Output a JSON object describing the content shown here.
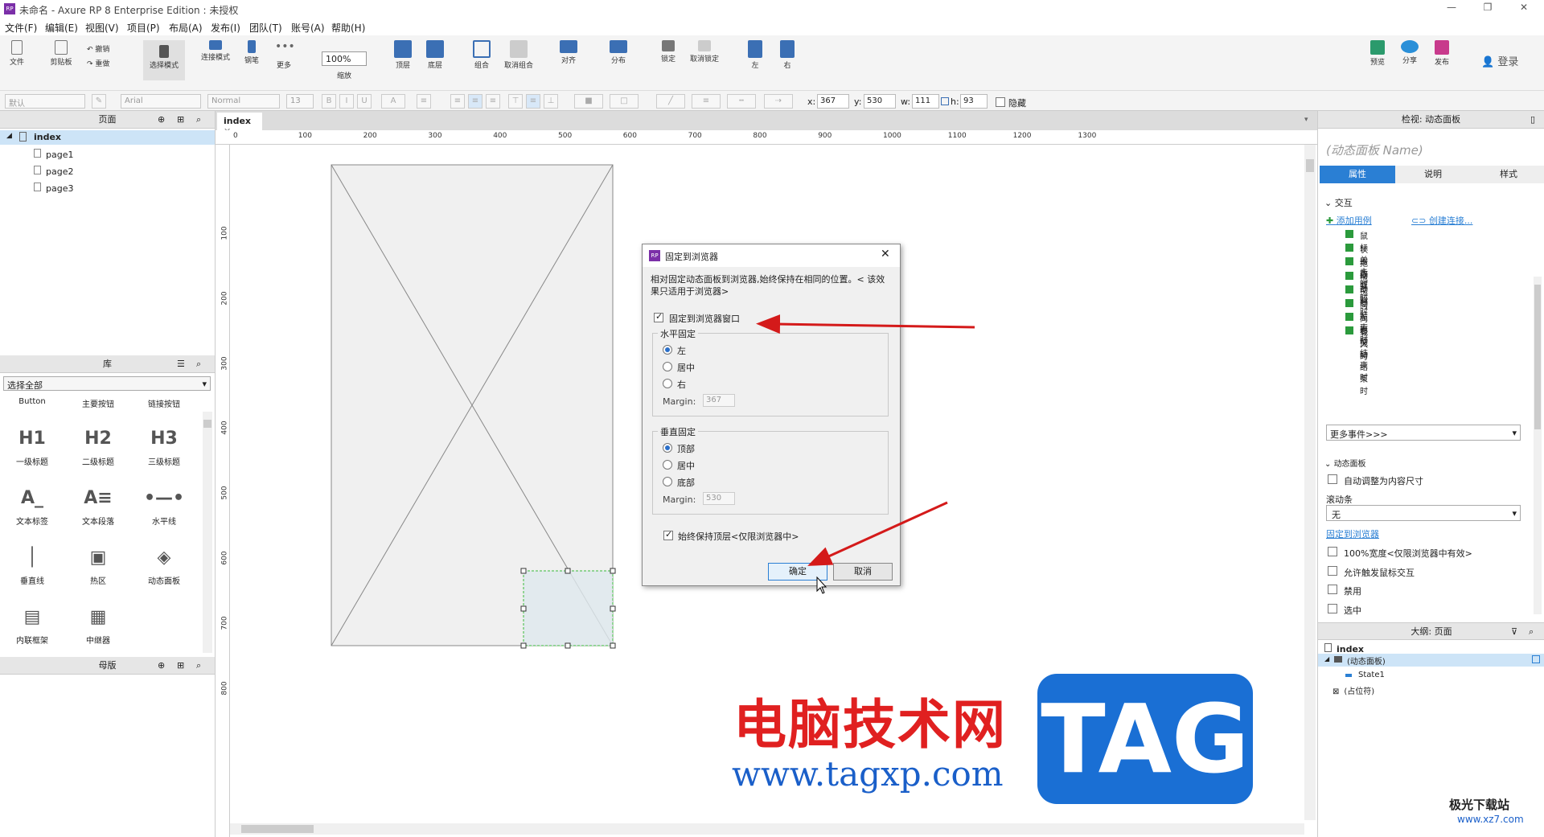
{
  "window": {
    "title": "未命名 - Axure RP 8 Enterprise Edition : 未授权"
  },
  "menu": [
    "文件(F)",
    "编辑(E)",
    "视图(V)",
    "项目(P)",
    "布局(A)",
    "发布(I)",
    "团队(T)",
    "账号(A)",
    "帮助(H)"
  ],
  "toolbar": {
    "file": "文件",
    "clipboard": "剪贴板",
    "undo": "撤销",
    "redo": "重做",
    "select_mode": "选择模式",
    "connect_mode": "连接模式",
    "pen": "钢笔",
    "more": "更多",
    "zoom_value": "100%",
    "zoom_label": "缩放",
    "top": "顶层",
    "bottom": "底层",
    "group": "组合",
    "ungroup": "取消组合",
    "align": "对齐",
    "distribute": "分布",
    "lock": "锁定",
    "unlock": "取消锁定",
    "left": "左",
    "right": "右",
    "preview": "预览",
    "share": "分享",
    "publish": "发布",
    "login": "登录"
  },
  "format": {
    "style": "默认",
    "font": "Arial",
    "weight": "Normal",
    "size": "13",
    "x_label": "x:",
    "x": "367",
    "y_label": "y:",
    "y": "530",
    "w_label": "w:",
    "w": "111",
    "h_label": "h:",
    "h": "93",
    "hidden": "隐藏"
  },
  "pages_panel": {
    "title": "页面",
    "root": "index",
    "pages": [
      "page1",
      "page2",
      "page3"
    ]
  },
  "library_panel": {
    "title": "库",
    "select": "选择全部",
    "top_row": [
      "Button",
      "主要按钮",
      "链接按钮"
    ],
    "items": [
      {
        "icon": "H1",
        "label": "一级标题"
      },
      {
        "icon": "H2",
        "label": "二级标题"
      },
      {
        "icon": "H3",
        "label": "三级标题"
      },
      {
        "icon": "A_",
        "label": "文本标签"
      },
      {
        "icon": "A≡",
        "label": "文本段落"
      },
      {
        "icon": "•—•",
        "label": "水平线"
      },
      {
        "icon": "│",
        "label": "垂直线"
      },
      {
        "icon": "▣",
        "label": "热区"
      },
      {
        "icon": "◈",
        "label": "动态面板"
      },
      {
        "icon": "▤",
        "label": "内联框架"
      },
      {
        "icon": "▦",
        "label": "中继器"
      }
    ]
  },
  "masters_panel": {
    "title": "母版"
  },
  "canvas": {
    "tab": "index",
    "ruler_x": [
      "0",
      "100",
      "200",
      "300",
      "400",
      "500",
      "600",
      "700",
      "800",
      "900",
      "1000",
      "1100",
      "1200",
      "1300"
    ],
    "ruler_y": [
      "100",
      "200",
      "300",
      "400",
      "500",
      "600",
      "700",
      "800"
    ]
  },
  "inspector": {
    "title": "检视: 动态面板",
    "name_placeholder": "(动态面板 Name)",
    "tabs": [
      "属性",
      "说明",
      "样式"
    ],
    "interaction": "交互",
    "add_case": "添加用例",
    "create_link": "创建连接...",
    "events": [
      "鼠标单击时",
      "状态改变时",
      "拖动开始时",
      "拖动时",
      "拖动结束时",
      "向左拖动结束时",
      "向右拖动结束时",
      "载入时"
    ],
    "more_events": "更多事件>>>",
    "dynamic_panel": "动态面板",
    "auto_fit": "自动调整为内容尺寸",
    "scrollbar_label": "滚动条",
    "scrollbar_value": "无",
    "pin_link": "固定到浏览器",
    "opt_100": "100%宽度<仅限浏览器中有效>",
    "opt_mouse": "允许触发鼠标交互",
    "opt_disable": "禁用",
    "opt_select": "选中"
  },
  "outline": {
    "title": "大纲: 页面",
    "page": "index",
    "panel": "(动态面板)",
    "state": "State1",
    "placeholder": "(占位符)"
  },
  "dialog": {
    "title": "固定到浏览器",
    "desc": "相对固定动态面板到浏览器,始终保持在相同的位置。< 该效果只适用于浏览器>",
    "pin_label": "固定到浏览器窗口",
    "horiz_group": "水平固定",
    "h_left": "左",
    "h_center": "居中",
    "h_right": "右",
    "margin_label": "Margin:",
    "h_margin": "367",
    "vert_group": "垂直固定",
    "v_top": "顶部",
    "v_center": "居中",
    "v_bottom": "底部",
    "v_margin": "530",
    "keep_top": "始终保持顶层<仅限浏览器中>",
    "ok": "确定",
    "cancel": "取消"
  },
  "watermark": {
    "site_cn": "电脑技术网",
    "url": "www.tagxp.com",
    "tag": "TAG",
    "corner": "极光下载站",
    "corner_url": "www.xz7.com"
  },
  "colors": {
    "accent": "#2a7fd4",
    "tab_active": "#2a7fd4",
    "arrow": "#d41a1a",
    "tag_bg": "#1a6fd4",
    "site_red": "#e02020"
  }
}
